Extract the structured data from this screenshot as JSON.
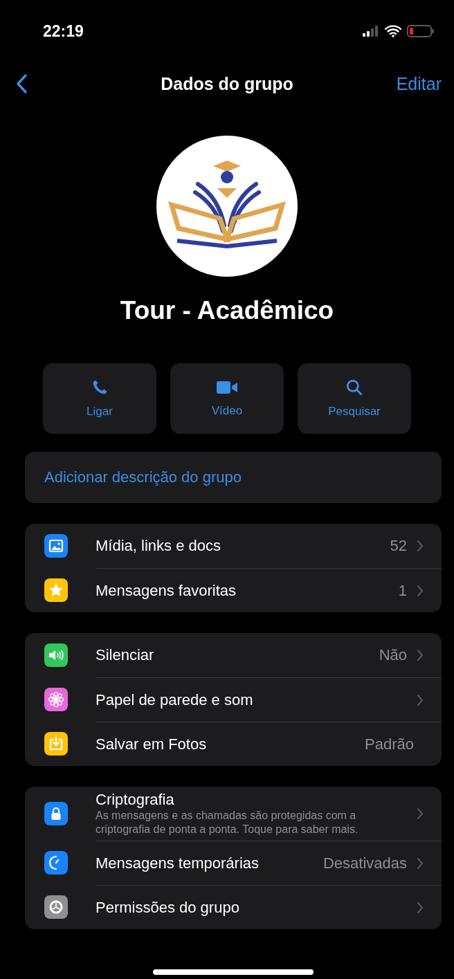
{
  "status_bar": {
    "time": "22:19"
  },
  "nav": {
    "title": "Dados do grupo",
    "action": "Editar"
  },
  "group": {
    "name": "Tour - Acadêmico"
  },
  "actions": [
    {
      "kind": "phone",
      "label": "Ligar"
    },
    {
      "kind": "video",
      "label": "Vídeo"
    },
    {
      "kind": "search",
      "label": "Pesquisar"
    }
  ],
  "description_link": "Adicionar descrição do grupo",
  "sections": [
    {
      "rows": [
        {
          "kind": "media",
          "color": "#1a82fb",
          "label": "Mídia, links e docs",
          "value": "52",
          "chevron": true
        },
        {
          "kind": "star",
          "color": "#fdc40b",
          "label": "Mensagens favoritas",
          "value": "1",
          "chevron": true
        }
      ]
    },
    {
      "rows": [
        {
          "kind": "speaker",
          "color": "#31c75a",
          "label": "Silenciar",
          "value": "Não",
          "chevron": true
        },
        {
          "kind": "flower",
          "color": "#e56ad8",
          "label": "Papel de parede e som",
          "chevron": true
        },
        {
          "kind": "download",
          "color": "#fdc40b",
          "label": "Salvar em Fotos",
          "value": "Padrão",
          "chevron": false
        }
      ]
    },
    {
      "rows": [
        {
          "kind": "lock",
          "color": "#1a82fb",
          "label": "Criptografia",
          "subtitle": "As mensagens e as chamadas são protegidas com a criptografia de ponta a ponta. Toque para saber mais.",
          "chevron": true
        },
        {
          "kind": "timer",
          "color": "#1a82fb",
          "label": "Mensagens temporárias",
          "value": "Desativadas",
          "chevron": true
        },
        {
          "kind": "gear",
          "color": "#8e8e93",
          "label": "Permissões do grupo",
          "chevron": true
        }
      ]
    }
  ]
}
